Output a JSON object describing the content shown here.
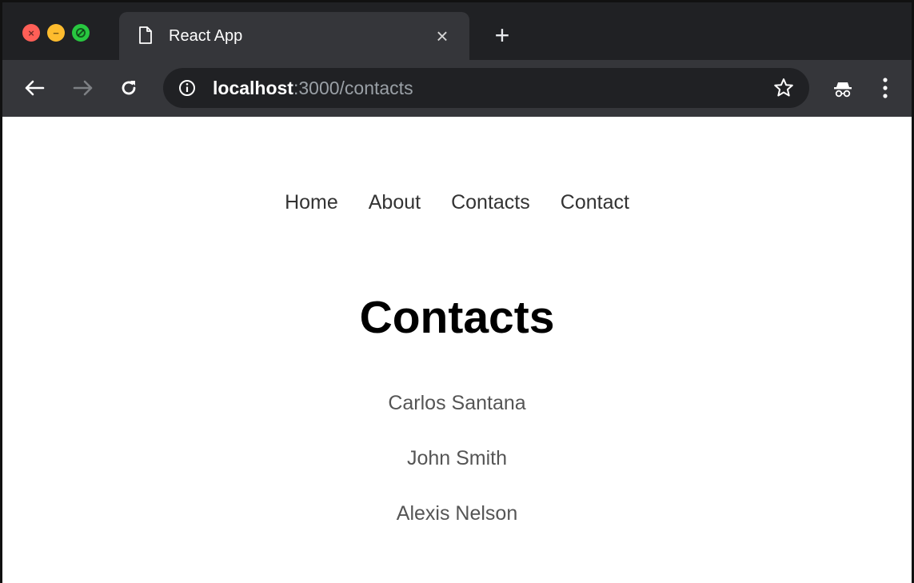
{
  "browser": {
    "tab_title": "React App",
    "tab_close": "×",
    "new_tab": "+",
    "url_host": "localhost",
    "url_path": ":3000/contacts"
  },
  "nav": {
    "items": [
      "Home",
      "About",
      "Contacts",
      "Contact"
    ]
  },
  "page": {
    "title": "Contacts",
    "contacts": [
      "Carlos Santana",
      "John Smith",
      "Alexis Nelson"
    ]
  },
  "colors": {
    "chrome_dark": "#202124",
    "chrome_tab": "#35363a",
    "close_light": "#ff5f57",
    "min_light": "#febc2e",
    "max_light": "#28c840"
  }
}
